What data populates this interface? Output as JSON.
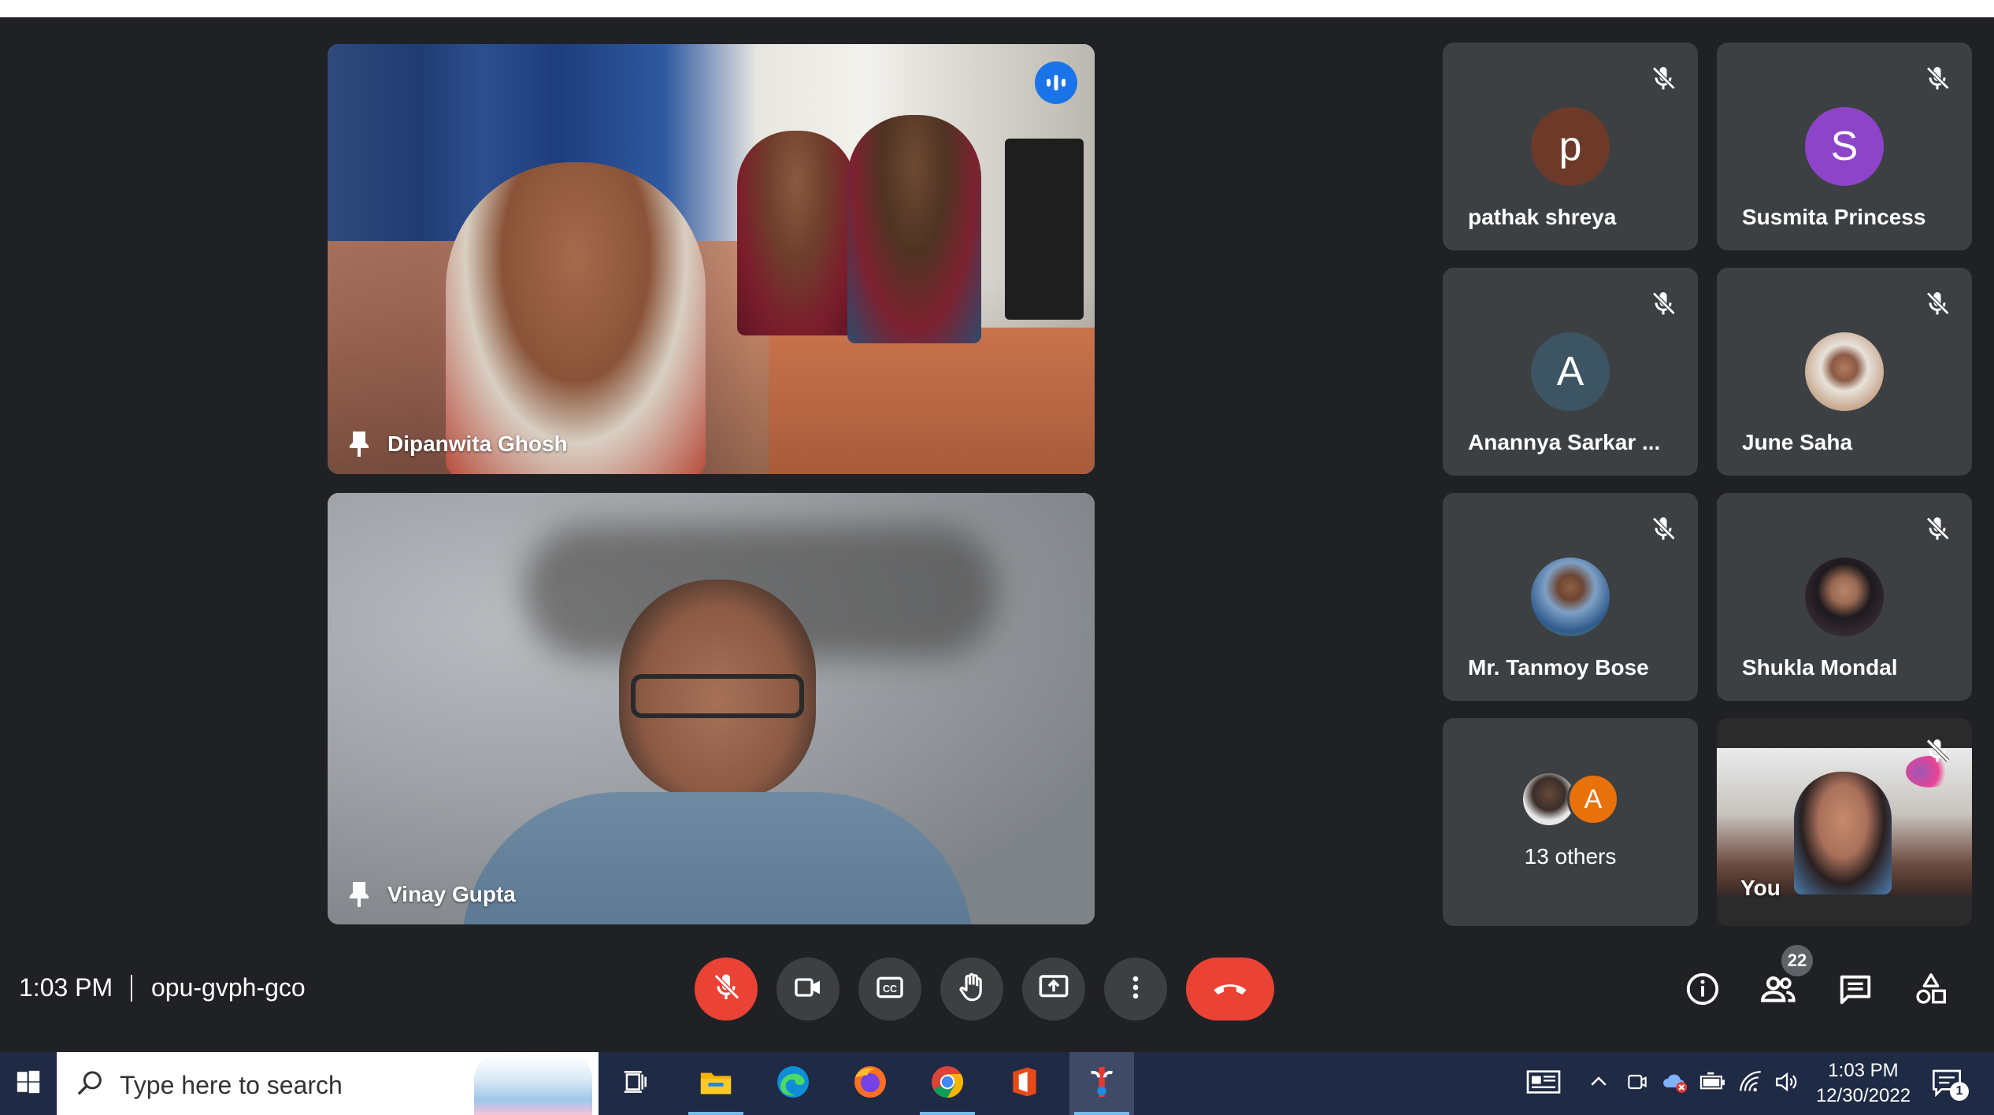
{
  "meeting": {
    "time": "1:03 PM",
    "code": "opu-gvph-gco"
  },
  "main_videos": [
    {
      "name": "Dipanwita Ghosh",
      "speaking": true
    },
    {
      "name": "Vinay Gupta",
      "speaking": false
    }
  ],
  "participants": [
    {
      "name": "pathak shreya",
      "initial": "p",
      "avatar_color": "#6d3a2a",
      "muted": true
    },
    {
      "name": "Susmita Princess",
      "initial": "S",
      "avatar_color": "#8e44c8",
      "muted": true
    },
    {
      "name": "Anannya Sarkar ...",
      "initial": "A",
      "avatar_color": "#3d5563",
      "muted": true
    },
    {
      "name": "June Saha",
      "initial": "",
      "avatar_color": "#cfc7bd",
      "muted": true
    },
    {
      "name": "Mr. Tanmoy Bose",
      "initial": "",
      "avatar_color": "#5b7fa6",
      "muted": true
    },
    {
      "name": "Shukla Mondal",
      "initial": "",
      "avatar_color": "#2e2a2e",
      "muted": true
    }
  ],
  "others": {
    "label": "13 others",
    "initial": "A",
    "avatar_color": "#e8710a"
  },
  "self": {
    "name": "You",
    "muted": true
  },
  "controls": {
    "mic": "mic-off",
    "camera": "camera",
    "captions": "closed-captions",
    "raise_hand": "hand",
    "present": "present-screen",
    "more": "more-options",
    "leave": "leave-call"
  },
  "right_controls": {
    "people_count": "22"
  },
  "taskbar": {
    "search_placeholder": "Type here to search",
    "time": "1:03 PM",
    "date": "12/30/2022",
    "notification_count": "1"
  },
  "colors": {
    "background": "#202124",
    "tile": "#3c4043",
    "accent": "#8ab4f8",
    "danger": "#ea4335",
    "taskbar": "#1f2a44"
  }
}
